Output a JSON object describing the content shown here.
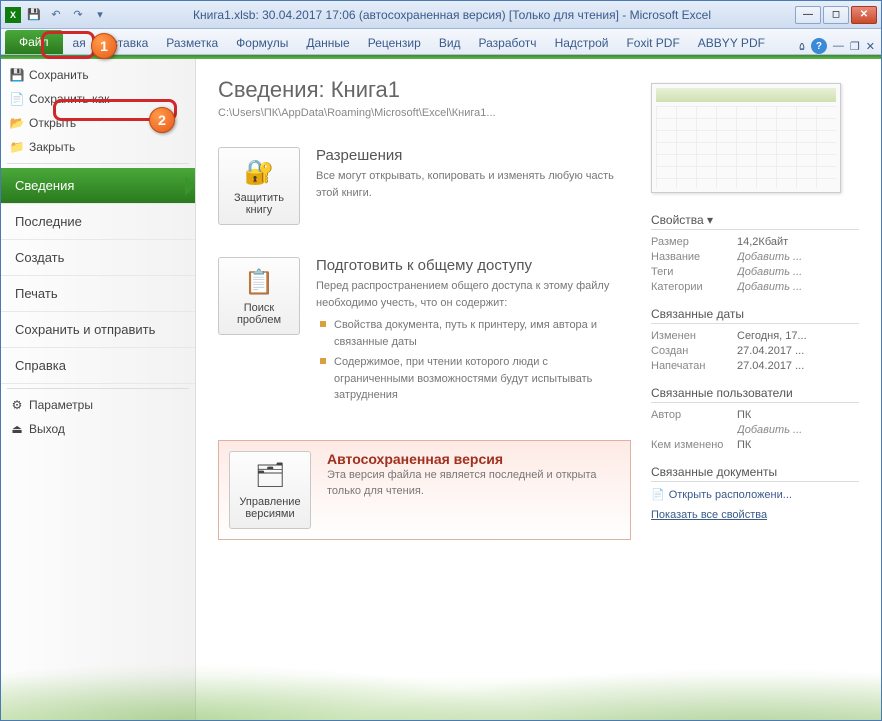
{
  "titlebar": {
    "title": "Книга1.xlsb: 30.04.2017 17:06 (автосохраненная версия)  [Только для чтения]  -  Microsoft Excel"
  },
  "ribbon": {
    "file": "Файл",
    "tabs": [
      "ая",
      "Вставка",
      "Разметка",
      "Формулы",
      "Данные",
      "Рецензир",
      "Вид",
      "Разработч",
      "Надстрой",
      "Foxit PDF",
      "ABBYY PDF"
    ]
  },
  "filemenu": {
    "save": "Сохранить",
    "save_as": "Сохранить как",
    "open": "Открыть",
    "close": "Закрыть",
    "info": "Сведения",
    "recent": "Последние",
    "new": "Создать",
    "print": "Печать",
    "share": "Сохранить и отправить",
    "help": "Справка",
    "options": "Параметры",
    "exit": "Выход"
  },
  "info": {
    "heading": "Сведения: Книга1",
    "path": "C:\\Users\\ПК\\AppData\\Roaming\\Microsoft\\Excel\\Книга1...",
    "protect_btn": "Защитить книгу",
    "perm_title": "Разрешения",
    "perm_text": "Все могут открывать, копировать и изменять любую часть этой книги.",
    "check_btn": "Поиск проблем",
    "prep_title": "Подготовить к общему доступу",
    "prep_text": "Перед распространением общего доступа к этому файлу необходимо учесть, что он содержит:",
    "prep_b1": "Свойства документа, путь к принтеру, имя автора и связанные даты",
    "prep_b2": "Содержимое, при чтении которого люди с ограниченными возможностями будут испытывать затруднения",
    "versions_btn": "Управление версиями",
    "auto_title": "Автосохраненная версия",
    "auto_text": "Эта версия файла не является последней и открыта только для чтения."
  },
  "props": {
    "header": "Свойства",
    "size_l": "Размер",
    "size_v": "14,2Кбайт",
    "title_l": "Название",
    "add": "Добавить ...",
    "tags_l": "Теги",
    "cat_l": "Категории",
    "dates_h": "Связанные даты",
    "mod_l": "Изменен",
    "mod_v": "Сегодня, 17...",
    "created_l": "Создан",
    "created_v": "27.04.2017 ...",
    "printed_l": "Напечатан",
    "printed_v": "27.04.2017 ...",
    "users_h": "Связанные пользователи",
    "author_l": "Автор",
    "author_v": "ПК",
    "lastmod_l": "Кем изменено",
    "lastmod_v": "ПК",
    "docs_h": "Связанные документы",
    "open_loc": "Открыть расположени...",
    "show_all": "Показать все свойства"
  },
  "callouts": {
    "one": "1",
    "two": "2"
  }
}
